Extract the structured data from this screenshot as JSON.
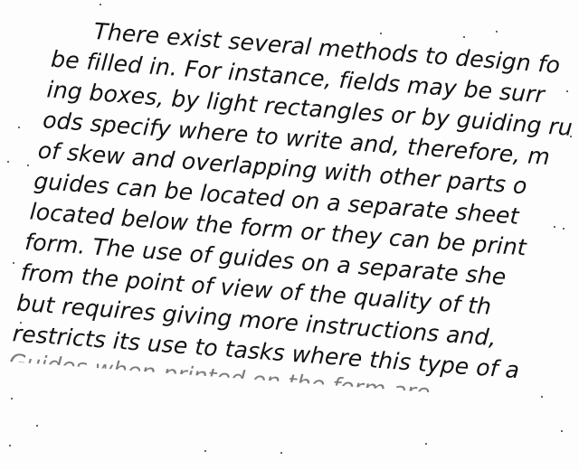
{
  "document": {
    "lines": [
      "There exist several methods to design fo",
      "be filled in. For instance, fields may be surr",
      "ing boxes, by light rectangles or by guiding ru",
      "ods specify where to write and, therefore, m",
      "of skew and overlapping with other parts o",
      "guides can be located on a separate sheet",
      "located below the form or they can be print",
      "form. The use of guides on a separate she",
      "from the point of view of the quality of th",
      "but requires giving more instructions and,",
      "restricts its use to tasks where this type of a",
      "Guides when printed on the form are"
    ]
  }
}
